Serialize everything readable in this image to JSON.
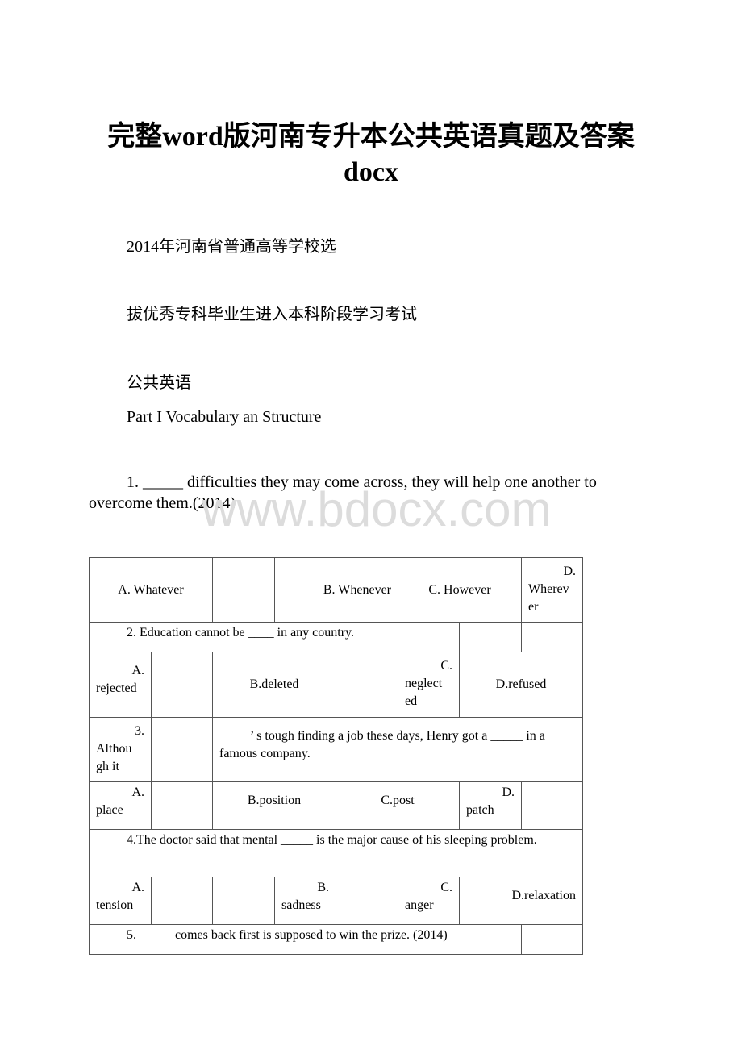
{
  "document": {
    "title_line1": "完整word版河南专升本公共英语真题及答案",
    "title_line2": "docx",
    "heading1": "2014年河南省普通高等学校选",
    "heading2": "拔优秀专科毕业生进入本科阶段学习考试",
    "subject": "公共英语",
    "part": "Part I Vocabulary an Structure",
    "q1": "1. _____ difficulties they may come across, they will help one another to overcome them.(2014)",
    "watermark": "www.bdocx.com"
  },
  "table": {
    "q1_options": {
      "a": "A. Whatever",
      "b": "B. Whenever",
      "c": "C. However",
      "d_1": "D.",
      "d_2": "Wherev",
      "d_3": "er"
    },
    "q2": "2. Education cannot be ____ in any country.",
    "q2_options": {
      "a_1": "A.",
      "a_2": "rejected",
      "b": "B.deleted",
      "c_1": "C.",
      "c_2": "neglect",
      "c_3": "ed",
      "d": "D.refused"
    },
    "q3": {
      "part1_1": "3.",
      "part1_2": "Althou",
      "part1_3": "gh it",
      "part2": "’ s tough finding a job these days, Henry got a _____ in a famous company."
    },
    "q3_options": {
      "a_1": "A.",
      "a_2": "place",
      "b": "B.position",
      "c": "C.post",
      "d_1": "D.",
      "d_2": "patch"
    },
    "q4": "4.The doctor said that mental _____ is the major cause of his sleeping problem.",
    "q4_options": {
      "a_1": "A.",
      "a_2": "tension",
      "b_1": "B.",
      "b_2": "sadness",
      "c_1": "C.",
      "c_2": "anger",
      "d": "D.relaxation"
    },
    "q5": "5. _____ comes back first is supposed to win the prize. (2014)"
  }
}
